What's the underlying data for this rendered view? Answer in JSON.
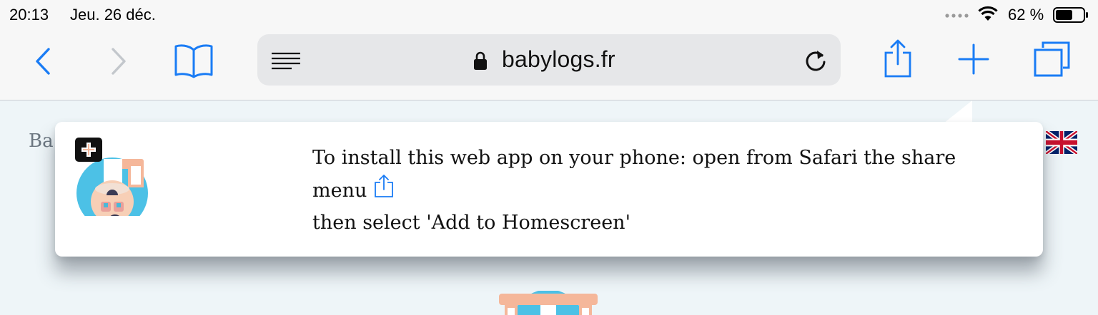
{
  "status_bar": {
    "time": "20:13",
    "date": "Jeu. 26 déc.",
    "battery_percent": "62 %",
    "battery_level": 0.62
  },
  "toolbar": {
    "url": "babylogs.fr",
    "icons": [
      "back-icon",
      "forward-icon",
      "bookmarks-icon",
      "reader-icon",
      "lock-icon",
      "reload-icon",
      "share-icon",
      "new-tab-icon",
      "tabs-icon"
    ]
  },
  "page": {
    "title_peek": "Ba"
  },
  "popup": {
    "line1": "To install this web app on your phone: open from Safari the share menu",
    "line2": "then select 'Add to Homescreen'"
  },
  "colors": {
    "accent": "#1a7cf5",
    "page_bg": "#eef5f8",
    "toolbar_bg": "#f7f7f7",
    "urlbar_bg": "#e6e7e9"
  }
}
